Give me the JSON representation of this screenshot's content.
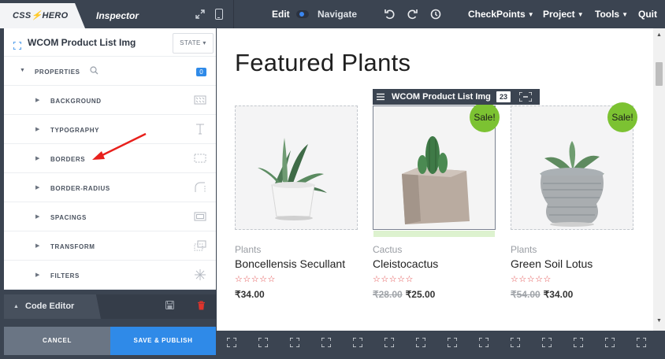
{
  "topbar": {
    "brand_left": "CSS",
    "brand_bolt": "⚡",
    "brand_right": "HERO",
    "inspector_tab": "Inspector",
    "edit_label": "Edit",
    "navigate_label": "Navigate",
    "menus": [
      {
        "label": "CheckPoints",
        "caret": "▼"
      },
      {
        "label": "Project",
        "caret": "▼"
      },
      {
        "label": "Tools",
        "caret": "▼"
      },
      {
        "label": "Quit",
        "caret": ""
      }
    ]
  },
  "panel": {
    "element_title": "WCOM Product List Img",
    "state_button": "STATE ▾",
    "properties_label": "PROPERTIES",
    "properties_count": "0",
    "properties": [
      {
        "label": "BACKGROUND",
        "icon": "background-icon"
      },
      {
        "label": "TYPOGRAPHY",
        "icon": "typography-icon"
      },
      {
        "label": "BORDERS",
        "icon": "borders-icon"
      },
      {
        "label": "BORDER-RADIUS",
        "icon": "border-radius-icon"
      },
      {
        "label": "SPACINGS",
        "icon": "spacings-icon"
      },
      {
        "label": "TRANSFORM",
        "icon": "transform-icon"
      },
      {
        "label": "FILTERS",
        "icon": "filters-icon"
      }
    ],
    "caret_right": "▶",
    "caret_down": "▼"
  },
  "code_editor": {
    "label": "Code Editor",
    "caret": "▲",
    "cancel": "CANCEL",
    "publish": "SAVE & PUBLISH"
  },
  "preview": {
    "title": "Featured Plants",
    "selection_label": "WCOM Product List Img",
    "selection_count": "23",
    "products": [
      {
        "category": "Plants",
        "name": "Boncellensis Secullant",
        "stars": "☆☆☆☆☆",
        "old_price": "",
        "price": "₹34.00",
        "sale": ""
      },
      {
        "category": "Cactus",
        "name": "Cleistocactus",
        "stars": "☆☆☆☆☆",
        "old_price": "₹28.00",
        "price": "₹25.00",
        "sale": "Sale!"
      },
      {
        "category": "Plants",
        "name": "Green Soil Lotus",
        "stars": "☆☆☆☆☆",
        "old_price": "₹54.00",
        "price": "₹34.00",
        "sale": "Sale!"
      }
    ]
  },
  "colors": {
    "chrome": "#3b4451",
    "accent_blue": "#2f8ae8",
    "sale_green": "#7cc232",
    "star_red": "#e24a4a",
    "arrow_red": "#e8201c"
  }
}
